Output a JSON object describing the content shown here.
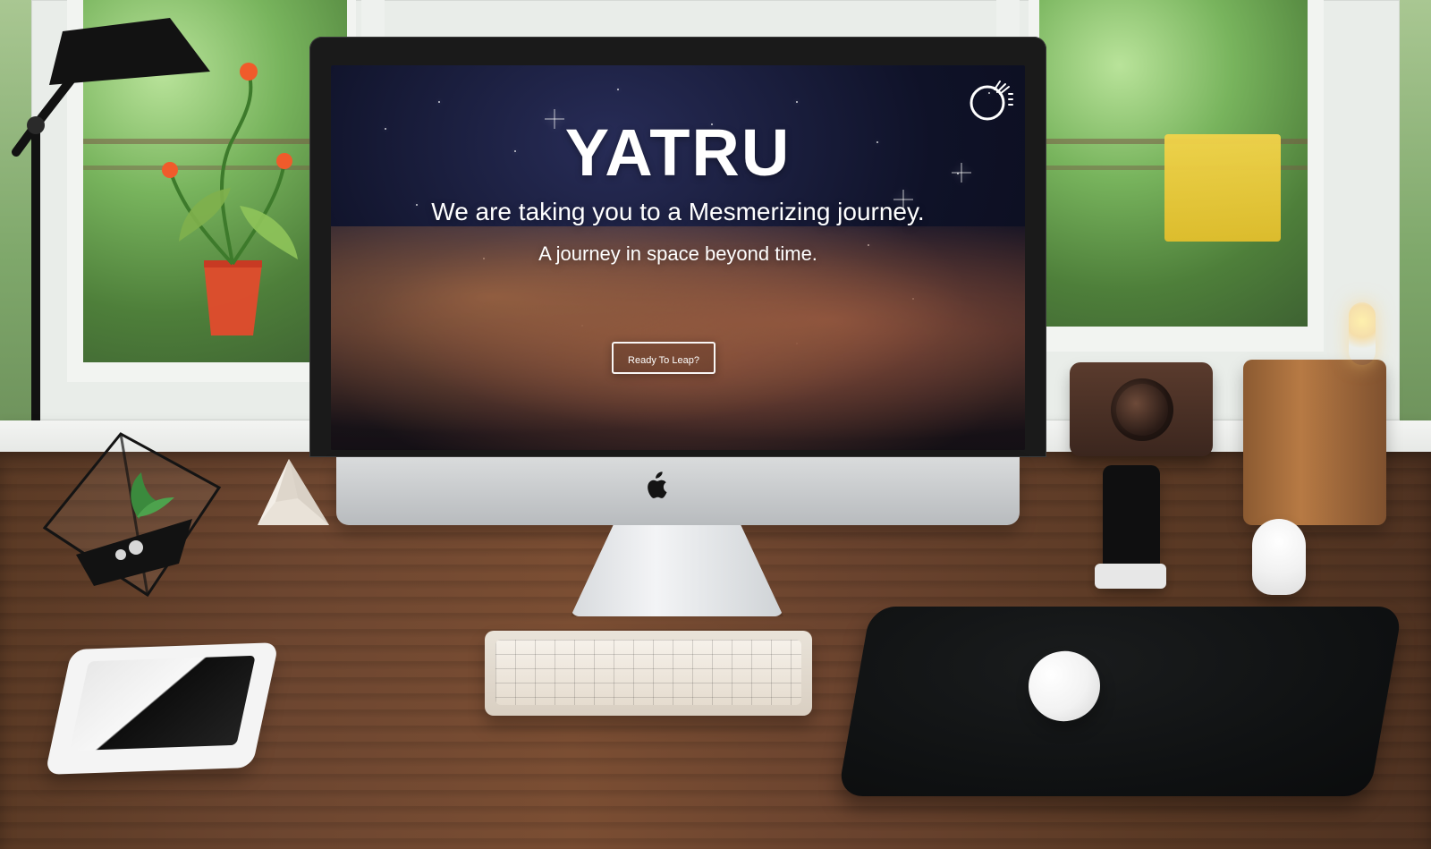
{
  "scene": {
    "website": {
      "logo_icon": "rocket-planet-icon",
      "title": "YATRU",
      "subtitle": "We are taking you to a Mesmerizing journey.",
      "tagline": "A journey in space beyond time.",
      "cta_label": "Ready To Leap?"
    },
    "device_logo": ""
  }
}
